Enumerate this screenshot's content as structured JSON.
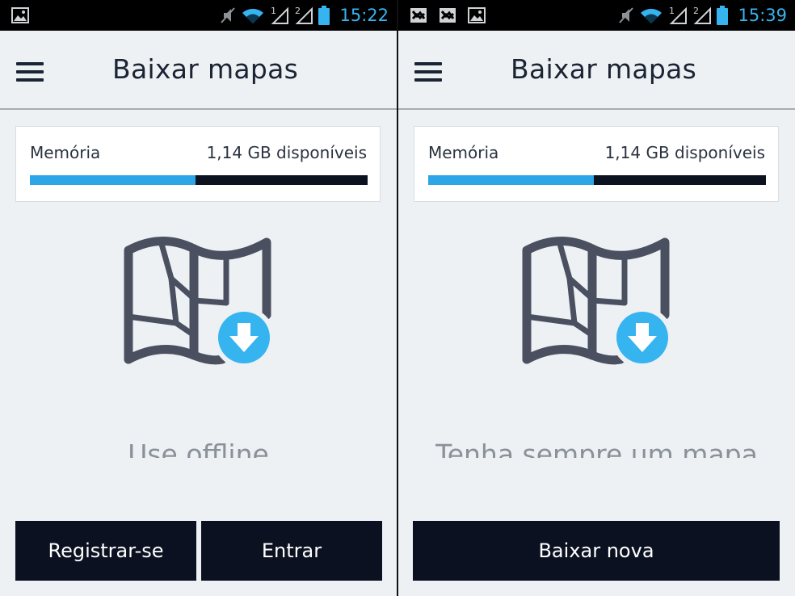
{
  "colors": {
    "accent": "#2ca6e6",
    "dark": "#0b1120",
    "background": "#edf1f4",
    "status_time": "#36b4f0"
  },
  "screens": [
    {
      "status_bar": {
        "time": "15:22",
        "left_icons": [
          "image-icon"
        ],
        "right_icons": [
          "mute-icon",
          "wifi-icon",
          "signal-1-icon",
          "signal-2-icon",
          "battery-icon"
        ],
        "signal_labels": [
          "1",
          "2"
        ]
      },
      "header": {
        "title": "Baixar mapas",
        "menu_icon": "hamburger-menu-icon"
      },
      "memory": {
        "label": "Memória",
        "value": "1,14 GB disponíveis",
        "used_fraction": 0.49
      },
      "illustration_icon": "map-download-icon",
      "carousel_text": "Use offline",
      "buttons": {
        "register": "Registrar-se",
        "login": "Entrar"
      }
    },
    {
      "status_bar": {
        "time": "15:39",
        "left_icons": [
          "screenshot-icon",
          "screenshot-icon",
          "image-icon"
        ],
        "right_icons": [
          "mute-icon",
          "wifi-icon",
          "signal-1-icon",
          "signal-2-icon",
          "battery-icon"
        ],
        "signal_labels": [
          "1",
          "2"
        ]
      },
      "header": {
        "title": "Baixar mapas",
        "menu_icon": "hamburger-menu-icon"
      },
      "memory": {
        "label": "Memória",
        "value": "1,14 GB disponíveis",
        "used_fraction": 0.49
      },
      "illustration_icon": "map-download-icon",
      "carousel_text": "Tenha sempre um mapa",
      "buttons": {
        "download": "Baixar nova"
      }
    }
  ]
}
